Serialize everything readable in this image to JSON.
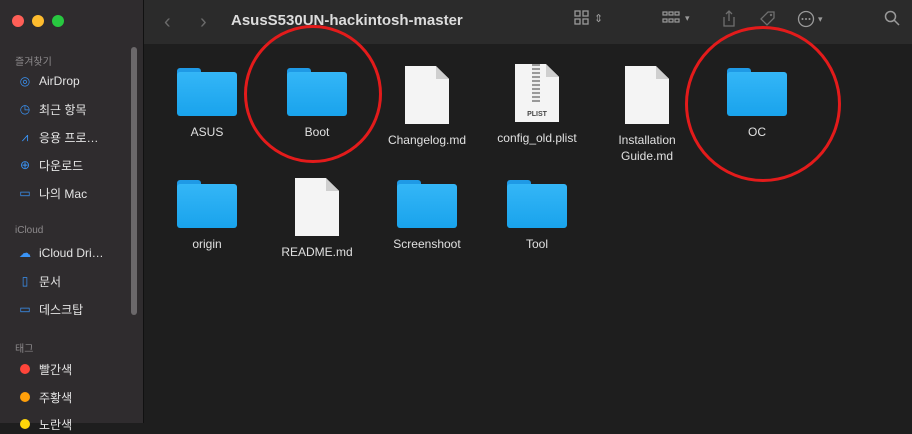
{
  "sidebar": {
    "favorites_heading": "즐겨찾기",
    "favorites": [
      {
        "label": "AirDrop",
        "icon": "airdrop-icon"
      },
      {
        "label": "최근 항목",
        "icon": "clock-icon"
      },
      {
        "label": "응용 프로…",
        "icon": "applications-icon"
      },
      {
        "label": "다운로드",
        "icon": "downloads-icon"
      },
      {
        "label": "나의 Mac",
        "icon": "folder-icon"
      }
    ],
    "icloud_heading": "iCloud",
    "icloud": [
      {
        "label": "iCloud Dri…",
        "icon": "cloud-icon"
      },
      {
        "label": "문서",
        "icon": "document-icon"
      },
      {
        "label": "데스크탑",
        "icon": "desktop-icon"
      }
    ],
    "tags_heading": "태그",
    "tags": [
      {
        "label": "빨간색",
        "color": "#ff453a"
      },
      {
        "label": "주황색",
        "color": "#ff9f0a"
      },
      {
        "label": "노란색",
        "color": "#ffd60a"
      }
    ]
  },
  "toolbar": {
    "title": "AsusS530UN-hackintosh-master"
  },
  "files": [
    {
      "name": "ASUS",
      "type": "folder"
    },
    {
      "name": "Boot",
      "type": "folder"
    },
    {
      "name": "Changelog.md",
      "type": "document"
    },
    {
      "name": "config_old.plist",
      "type": "plist",
      "badge": "PLIST"
    },
    {
      "name": "Installation Guide.md",
      "type": "document"
    },
    {
      "name": "OC",
      "type": "folder"
    },
    {
      "name": "origin",
      "type": "folder"
    },
    {
      "name": "README.md",
      "type": "document"
    },
    {
      "name": "Screenshoot",
      "type": "folder"
    },
    {
      "name": "Tool",
      "type": "folder"
    }
  ],
  "annotations": {
    "circle_color": "#e31b1b",
    "circled_items": [
      "Boot",
      "OC"
    ]
  }
}
